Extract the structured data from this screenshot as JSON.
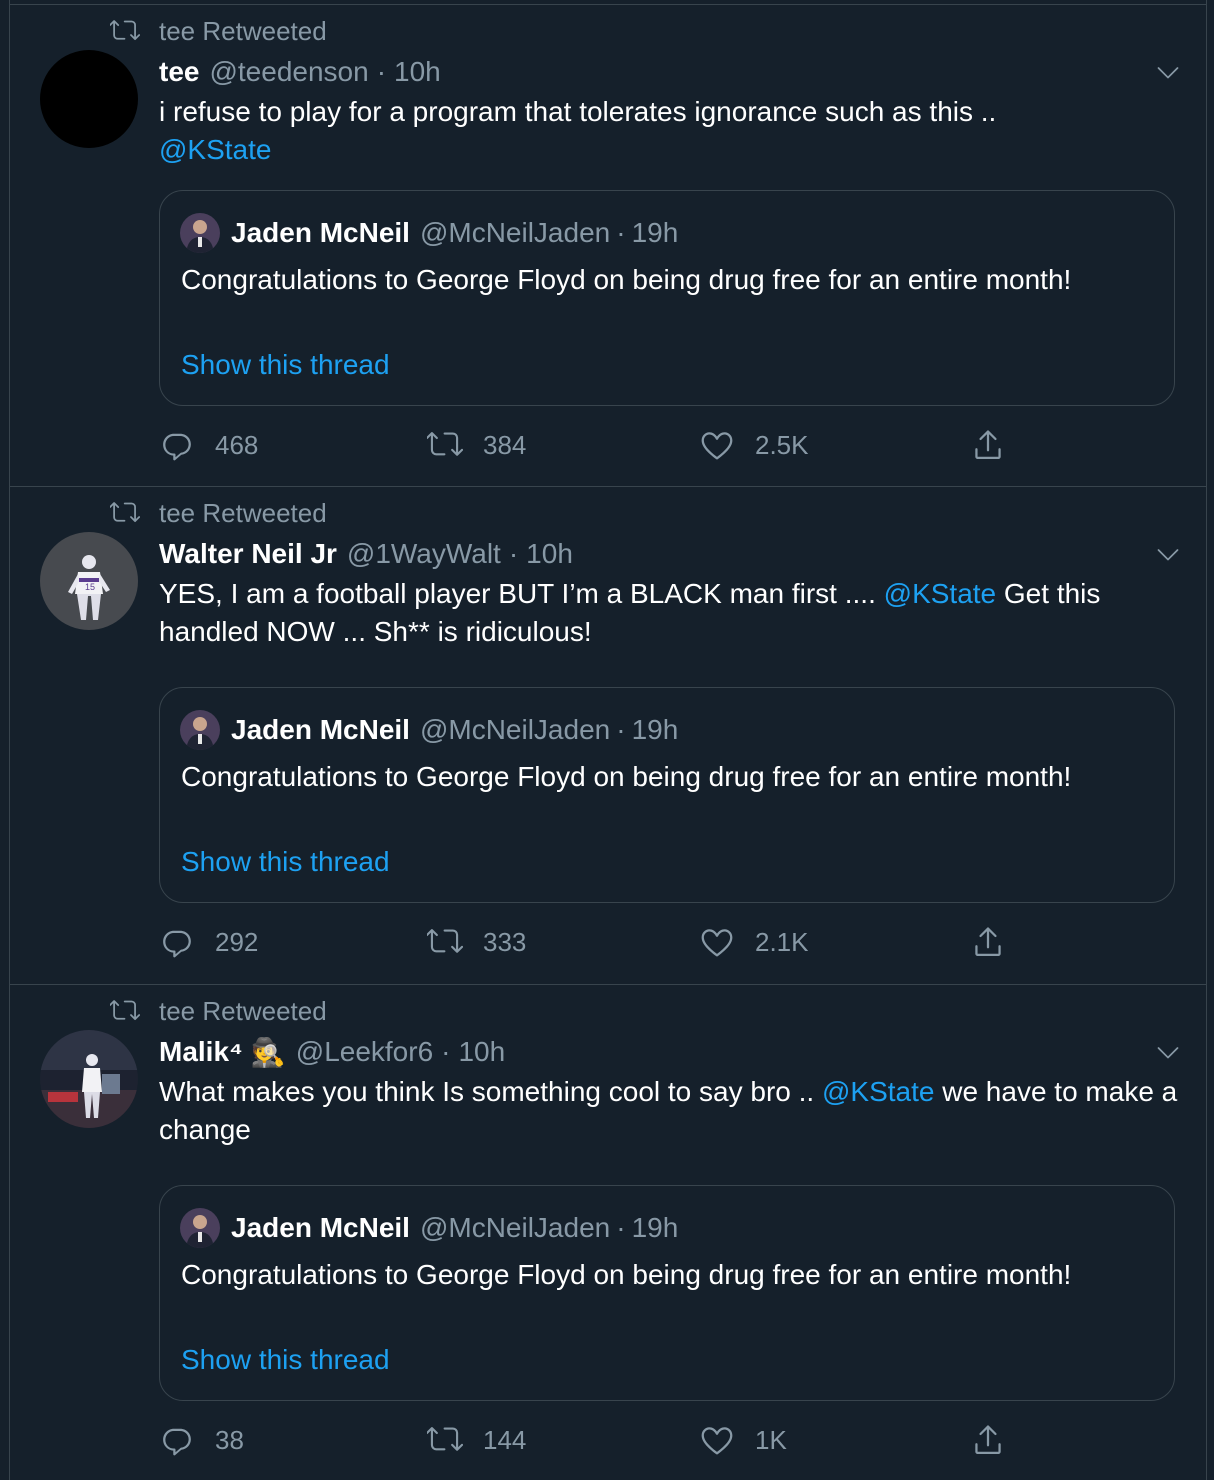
{
  "colors": {
    "background": "#15202b",
    "border": "#38444d",
    "secondary_text": "#8899a6",
    "accent": "#1da1f2",
    "primary_text": "#ffffff"
  },
  "tweets": [
    {
      "retweet_label": "tee Retweeted",
      "author_name": "tee",
      "author_handle": "@teedenson",
      "separator": "·",
      "time": "10h",
      "text_parts": [
        "i refuse to play for a program that tolerates ignorance such as this .. ",
        "@KState",
        ""
      ],
      "quote": {
        "author_name": "Jaden McNeil",
        "author_handle": "@McNeilJaden",
        "separator": "·",
        "time": "19h",
        "text": "Congratulations to George Floyd on being drug free for an entire month!",
        "thread_link": "Show this thread"
      },
      "replies": "468",
      "retweets": "384",
      "likes": "2.5K"
    },
    {
      "retweet_label": "tee Retweeted",
      "author_name": "Walter Neil Jr",
      "author_handle": "@1WayWalt",
      "separator": "·",
      "time": "10h",
      "text_parts": [
        "YES, I am a football player BUT I’m a BLACK man first ....  ",
        "@KState",
        " Get this handled NOW ... Sh** is ridiculous!"
      ],
      "quote": {
        "author_name": "Jaden McNeil",
        "author_handle": "@McNeilJaden",
        "separator": "·",
        "time": "19h",
        "text": "Congratulations to George Floyd on being drug free for an entire month!",
        "thread_link": "Show this thread"
      },
      "replies": "292",
      "retweets": "333",
      "likes": "2.1K"
    },
    {
      "retweet_label": "tee Retweeted",
      "author_name": "Malik⁴",
      "author_emoji": "🕵",
      "author_handle": "@Leekfor6",
      "separator": "·",
      "time": "10h",
      "text_parts": [
        "What makes you think Is something cool to say bro .. ",
        "@KState",
        "  we have to make a change"
      ],
      "quote": {
        "author_name": "Jaden McNeil",
        "author_handle": "@McNeilJaden",
        "separator": "·",
        "time": "19h",
        "text": "Congratulations to George Floyd on being drug free for an entire month!",
        "thread_link": "Show this thread"
      },
      "replies": "38",
      "retweets": "144",
      "likes": "1K"
    }
  ],
  "icons": {
    "retweeted_indicator": "retweet-icon",
    "menu": "chevron-down-icon",
    "reply": "reply-icon",
    "retweet": "retweet-icon",
    "like": "heart-icon",
    "share": "share-icon"
  }
}
